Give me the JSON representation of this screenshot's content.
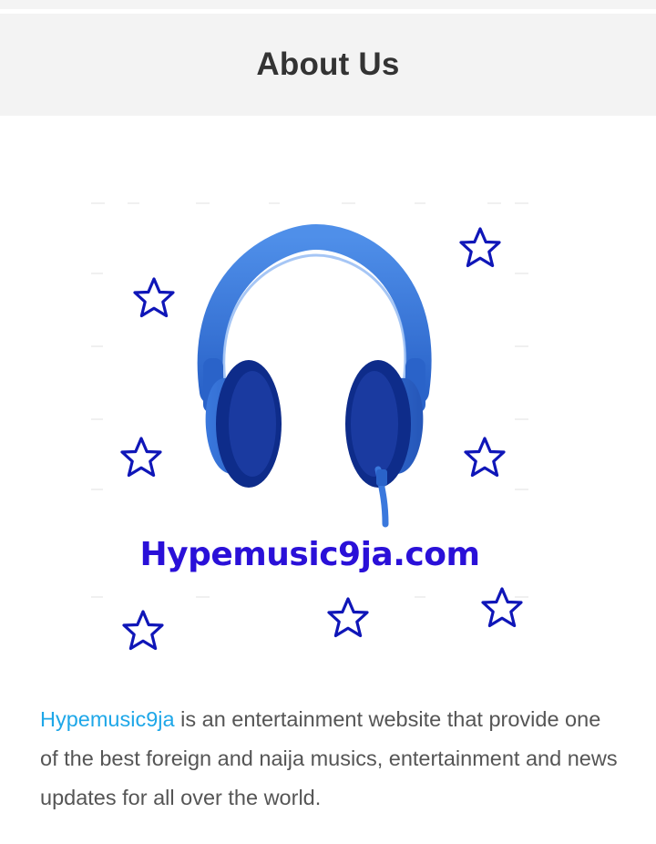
{
  "header": {
    "title": "About Us"
  },
  "logo": {
    "wordmark": "Hypemusic9ja.com",
    "icon": "headphones-icon",
    "star_icon": "star-icon",
    "colors": {
      "headphones": "#2f6fd6",
      "wordmark": "#2a10d8",
      "stars": "#0f16b8"
    }
  },
  "intro": {
    "link_text": "Hypemusic9ja",
    "body_text": " is an entertainment website that provide one of the best foreign and naija musics, entertainment and news updates for all over the world.",
    "link_color": "#1ea7e8"
  }
}
